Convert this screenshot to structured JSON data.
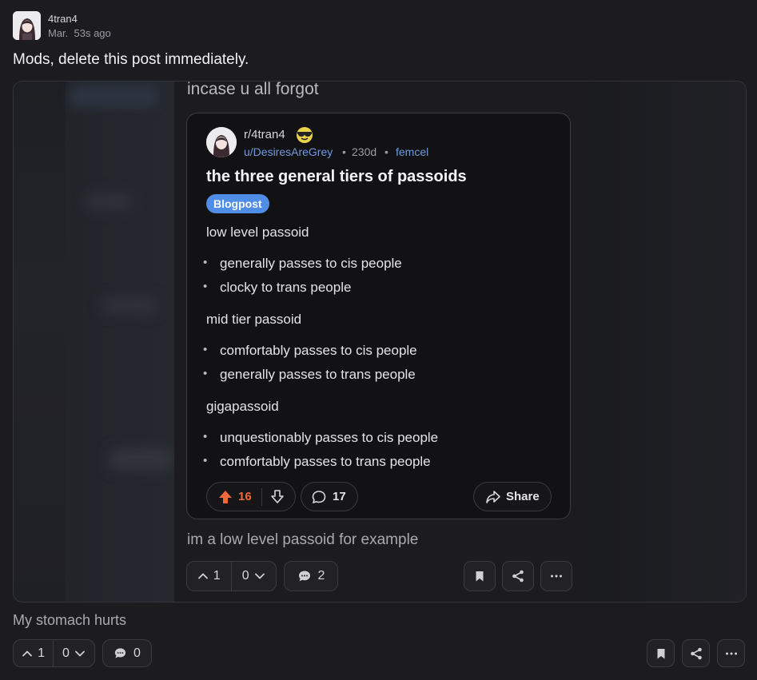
{
  "post": {
    "username": "4tran4",
    "timestamp": "Mar.  53s ago",
    "title": "Mods, delete this post immediately.",
    "caption_top": "incase u all forgot",
    "caption_bottom": "im a low level passoid for example",
    "embed_votes": {
      "up": "1",
      "down": "0",
      "comments": "2"
    }
  },
  "reddit": {
    "subreddit": "r/4tran4",
    "user": "u/DesiresAreGrey",
    "age": "230d",
    "flair_user": "femcel",
    "title": "the three general tiers of passoids",
    "tag": "Blogpost",
    "sections": [
      {
        "heading": "low level passoid",
        "bullets": [
          "generally passes to cis people",
          "clocky to trans people"
        ]
      },
      {
        "heading": "mid tier passoid",
        "bullets": [
          "comfortably passes to cis people",
          "generally passes to trans people"
        ]
      },
      {
        "heading": "gigapassoid",
        "bullets": [
          "unquestionably passes to cis people",
          "comfortably passes to trans people"
        ]
      }
    ],
    "upvotes": "16",
    "comments": "17",
    "share_label": "Share"
  },
  "reply": {
    "text": "My stomach hurts",
    "votes": {
      "up": "1",
      "down": "0",
      "comments": "0"
    }
  },
  "colors": {
    "accent_blue": "#4f8de6",
    "upvote_orange": "#f0683c",
    "background": "#1c1c20"
  }
}
